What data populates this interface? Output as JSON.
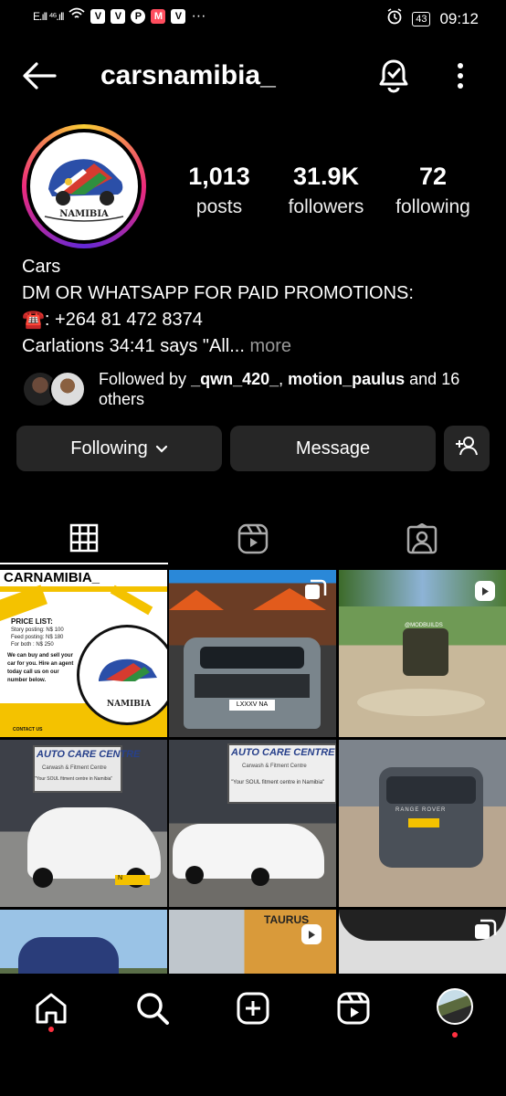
{
  "status_bar": {
    "signal": "E.ıll ⁴⁶.ıll",
    "app_badges": [
      "V",
      "V",
      "P",
      "M",
      "V"
    ],
    "more": "···",
    "battery": "43",
    "time": "09:12"
  },
  "header": {
    "username": "carsnamibia_",
    "back_icon": "back-arrow-icon",
    "bell_icon": "notification-bell-icon",
    "menu_icon": "more-vertical-icon"
  },
  "profile": {
    "avatar_text": "NAMIBIA",
    "stats": [
      {
        "value": "1,013",
        "label": "posts"
      },
      {
        "value": "31.9K",
        "label": "followers"
      },
      {
        "value": "72",
        "label": "following"
      }
    ]
  },
  "bio": {
    "category": "Cars",
    "line1": "DM OR WHATSAPP FOR PAID PROMOTIONS:",
    "phone": "☎️: +264 81 472 8374",
    "line3": "Carlations 34:41 says \"All...",
    "more": "more"
  },
  "followed_by": {
    "prefix": "Followed by ",
    "user1": "_qwn_420_",
    "sep": ", ",
    "user2": "motion_paulus",
    "suffix": " and 16 others"
  },
  "buttons": {
    "following": "Following",
    "message": "Message"
  },
  "grid": {
    "post1_title": "CARNAMIBIA_",
    "post1_price_heading": "PRICE LIST:",
    "post1_prices": [
      "Story posting: N$ 100",
      "Feed posting: N$ 180",
      "For both : N$ 250"
    ],
    "post1_body": "We can buy and sell your car for you. Hire an agent today call us on our number below.",
    "post1_logo": "NAMIBIA",
    "post1_contact": "CONTACT US",
    "post2_plate": "LXXXV NA",
    "post3_watermark": "@MODBUILDS",
    "post4_sign": "AUTO CARE CENTRE",
    "post4_sub": "Carwash & Fitment Centre",
    "post4_tagline": "\"Your SOUL fitment centre in Namibia\"",
    "post4_plate": "N",
    "post5_sign": "AUTO CARE CENTRE",
    "post5_sub": "Carwash & Fitment Centre",
    "post5_tagline": "\"Your SOUL fitment centre in Namibia\"",
    "post6_badge": "RANGE ROVER",
    "post8_sign": "TAURUS"
  },
  "nav": [
    "home-icon",
    "search-icon",
    "create-icon",
    "reels-icon",
    "profile-avatar"
  ]
}
